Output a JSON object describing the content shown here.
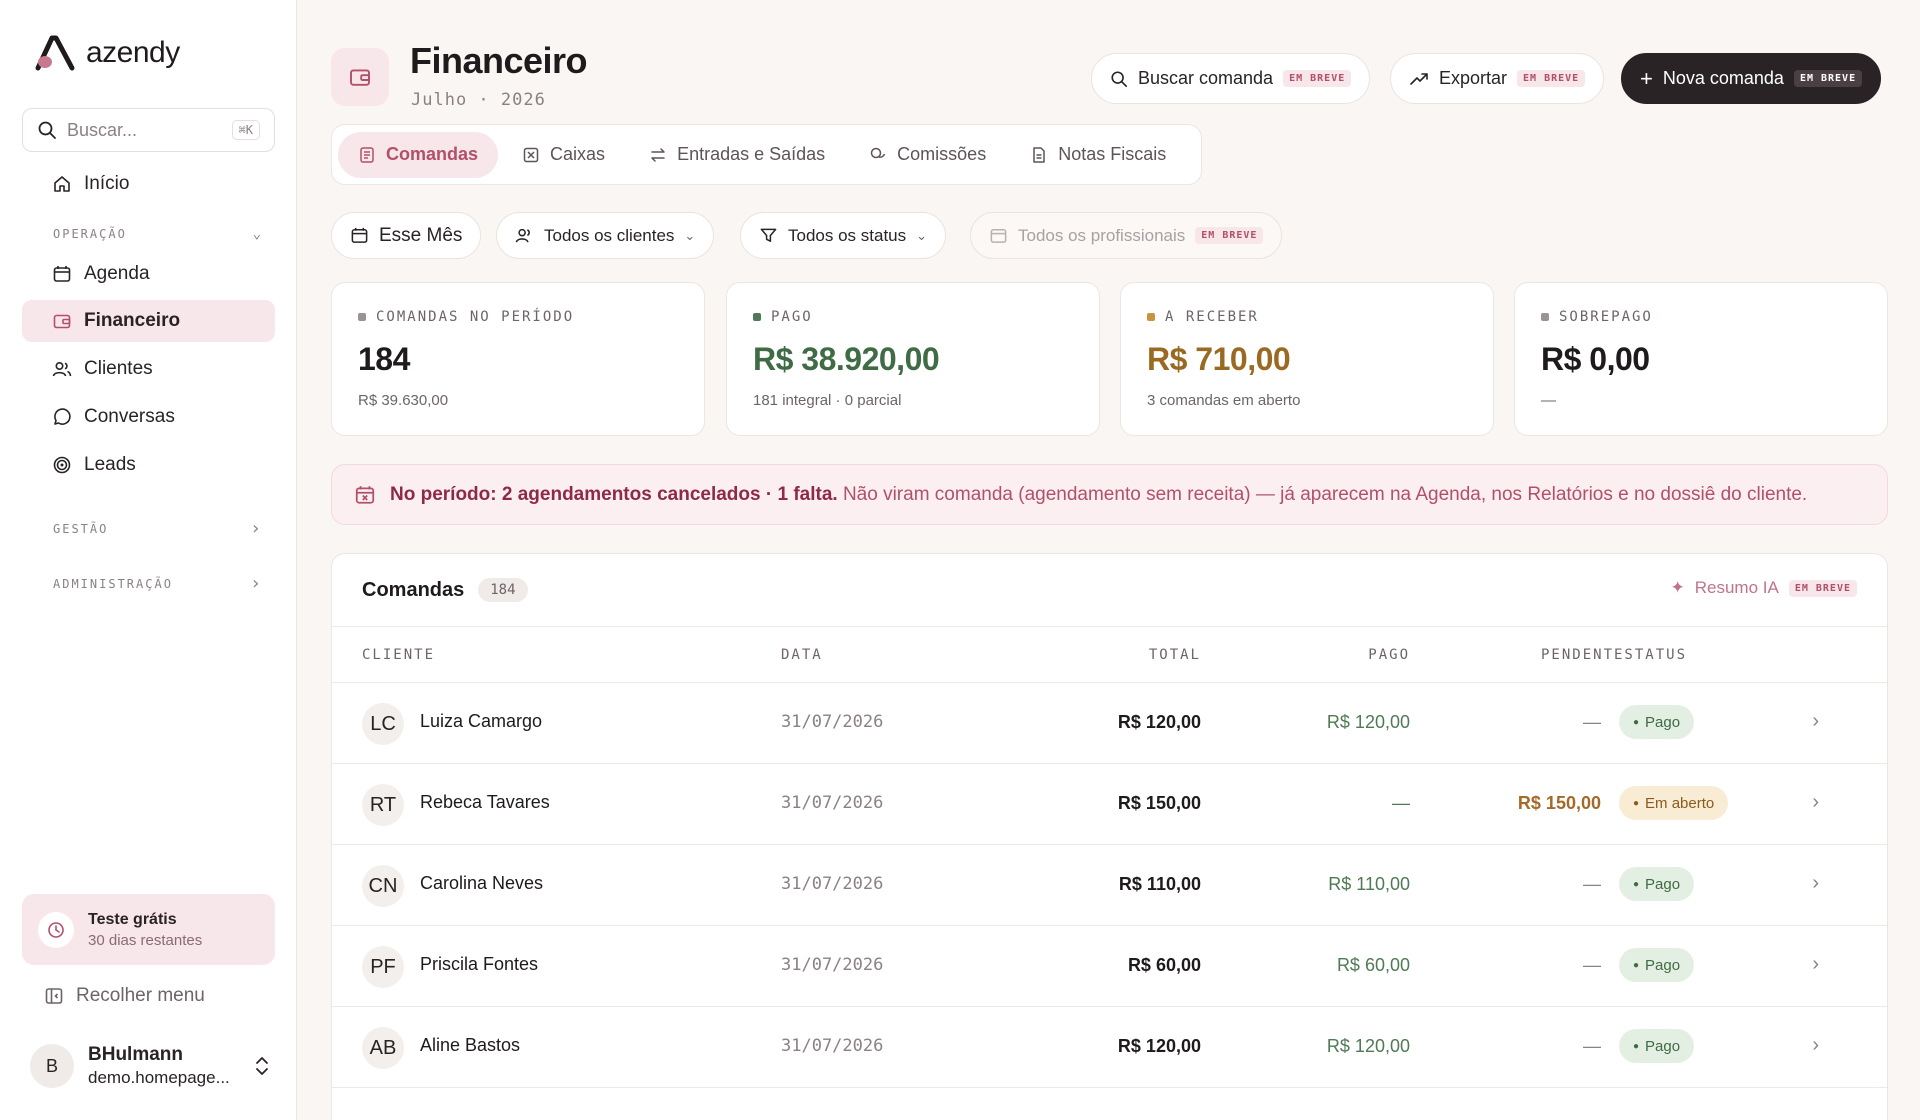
{
  "app": {
    "name": "azendy"
  },
  "sidebar": {
    "search_placeholder": "Buscar...",
    "search_kbd": "⌘K",
    "home": "Início",
    "sections": [
      {
        "label": "OPERAÇÃO",
        "expanded": true
      },
      {
        "label": "GESTÃO",
        "expanded": false
      },
      {
        "label": "ADMINISTRAÇÃO",
        "expanded": false
      }
    ],
    "items": [
      "Agenda",
      "Financeiro",
      "Clientes",
      "Conversas",
      "Leads"
    ],
    "active_item": "Financeiro",
    "trial": {
      "title": "Teste grátis",
      "subtitle": "30 dias restantes"
    },
    "collapse_label": "Recolher menu",
    "user": {
      "initial": "B",
      "name": "BHulmann",
      "email": "demo.homepage..."
    }
  },
  "header": {
    "title": "Financeiro",
    "subtitle": "Julho · 2026",
    "buttons": {
      "search": "Buscar comanda",
      "export": "Exportar",
      "new": "Nova comanda",
      "soon_badge": "EM BREVE"
    }
  },
  "tabs": [
    "Comandas",
    "Caixas",
    "Entradas e Saídas",
    "Comissões",
    "Notas Fiscais"
  ],
  "filters": {
    "period": "Esse Mês",
    "clients": "Todos os clientes",
    "status": "Todos os status",
    "professionals": "Todos os profissionais"
  },
  "stats": [
    {
      "label": "COMANDAS NO PERÍODO",
      "value": "184",
      "sub": "R$ 39.630,00",
      "color": "#9a9396",
      "value_color": "#1f1a1c"
    },
    {
      "label": "PAGO",
      "value": "R$ 38.920,00",
      "sub": "181 integral · 0 parcial",
      "color": "#4f7a55",
      "value_color": "#3f6b45"
    },
    {
      "label": "A RECEBER",
      "value": "R$ 710,00",
      "sub": "3 comandas em aberto",
      "color": "#c99440",
      "value_color": "#9a6a22"
    },
    {
      "label": "SOBREPAGO",
      "value": "R$ 0,00",
      "sub": "—",
      "color": "#9a9396",
      "value_color": "#1f1a1c"
    }
  ],
  "alert": {
    "bold": "No período: 2 agendamentos cancelados · 1 falta.",
    "text": "Não viram comanda (agendamento sem receita) — já aparecem na Agenda, nos Relatórios e no dossiê do cliente."
  },
  "table": {
    "title": "Comandas",
    "count": "184",
    "resumo": "Resumo IA",
    "columns": {
      "client": "CLIENTE",
      "date": "DATA",
      "total": "TOTAL",
      "paid": "PAGO",
      "pending_status": "PENDENTESTATUS"
    },
    "rows": [
      {
        "initials": "LC",
        "name": "Luiza Camargo",
        "date": "31/07/2026",
        "total": "R$ 120,00",
        "paid": "R$ 120,00",
        "pending": "—",
        "status": "Pago",
        "status_kind": "pago"
      },
      {
        "initials": "RT",
        "name": "Rebeca Tavares",
        "date": "31/07/2026",
        "total": "R$ 150,00",
        "paid": "—",
        "pending": "R$ 150,00",
        "status": "Em aberto",
        "status_kind": "aberto"
      },
      {
        "initials": "CN",
        "name": "Carolina Neves",
        "date": "31/07/2026",
        "total": "R$ 110,00",
        "paid": "R$ 110,00",
        "pending": "—",
        "status": "Pago",
        "status_kind": "pago"
      },
      {
        "initials": "PF",
        "name": "Priscila Fontes",
        "date": "31/07/2026",
        "total": "R$ 60,00",
        "paid": "R$ 60,00",
        "pending": "—",
        "status": "Pago",
        "status_kind": "pago"
      },
      {
        "initials": "AB",
        "name": "Aline Bastos",
        "date": "31/07/2026",
        "total": "R$ 120,00",
        "paid": "R$ 120,00",
        "pending": "—",
        "status": "Pago",
        "status_kind": "pago"
      }
    ]
  },
  "colors": {
    "accent": "#b2506a",
    "accent_bg": "#f7e6ea",
    "dark": "#2a2326"
  }
}
